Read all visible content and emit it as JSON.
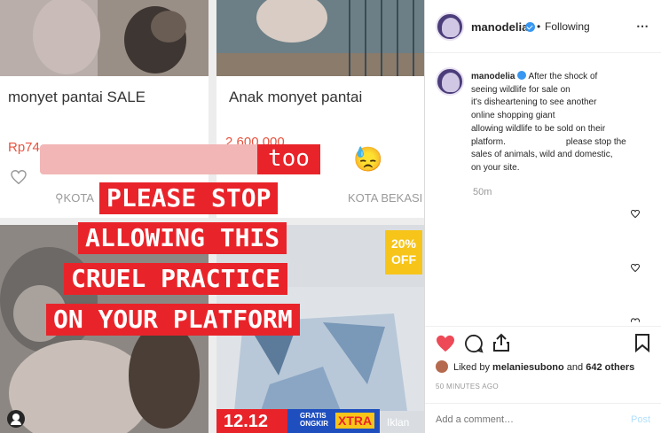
{
  "post_image": {
    "cards": [
      {
        "title": "monyet pantai SALE",
        "price": "Rp74",
        "location": "KOTA"
      },
      {
        "title": "Anak monyet pantai",
        "price": "2.600.000",
        "location": "KOTA BEKASI"
      }
    ],
    "overlay": {
      "line1": "too",
      "line1_emoji": "😓",
      "line2": "PLEASE STOP",
      "line3": "ALLOWING THIS",
      "line4": "CRUEL PRACTICE",
      "line5": "ON YOUR PLATFORM"
    },
    "discount_badge": {
      "line1": "20%",
      "line2": "OFF"
    },
    "promo": {
      "date": "12.12",
      "gratis": "GRATIS",
      "ongkir": "ONGKIR",
      "xtra": "XTRA",
      "iklan": "Iklan"
    },
    "colors": {
      "overlay_red": "#e8242a",
      "price_orange": "#e8533f",
      "badge_yellow": "#f7c51a"
    }
  },
  "sidebar": {
    "header": {
      "username": "manodelia",
      "separator": "•",
      "follow_status": "Following",
      "more_icon": "⋯"
    },
    "caption": {
      "username": "manodelia",
      "lines": [
        "After the shock of",
        "seeing wildlife for sale on",
        "it's disheartening to see another",
        "online shopping giant",
        "allowing wildlife to be sold on their",
        "platform.",
        "please stop the",
        "sales of animals, wild and domestic,",
        "on your site."
      ],
      "time_ago": "50m"
    },
    "actions": {
      "liked_by_prefix": "Liked by",
      "liked_by_user": "melaniesubono",
      "liked_by_suffix": "and",
      "liked_count": "642 others",
      "timestamp": "50 MINUTES AGO"
    },
    "comment": {
      "placeholder": "Add a comment…",
      "post_label": "Post"
    },
    "colors": {
      "verified_blue": "#3897f0",
      "like_red": "#ed4956",
      "post_blue": "#b2dffc"
    }
  }
}
